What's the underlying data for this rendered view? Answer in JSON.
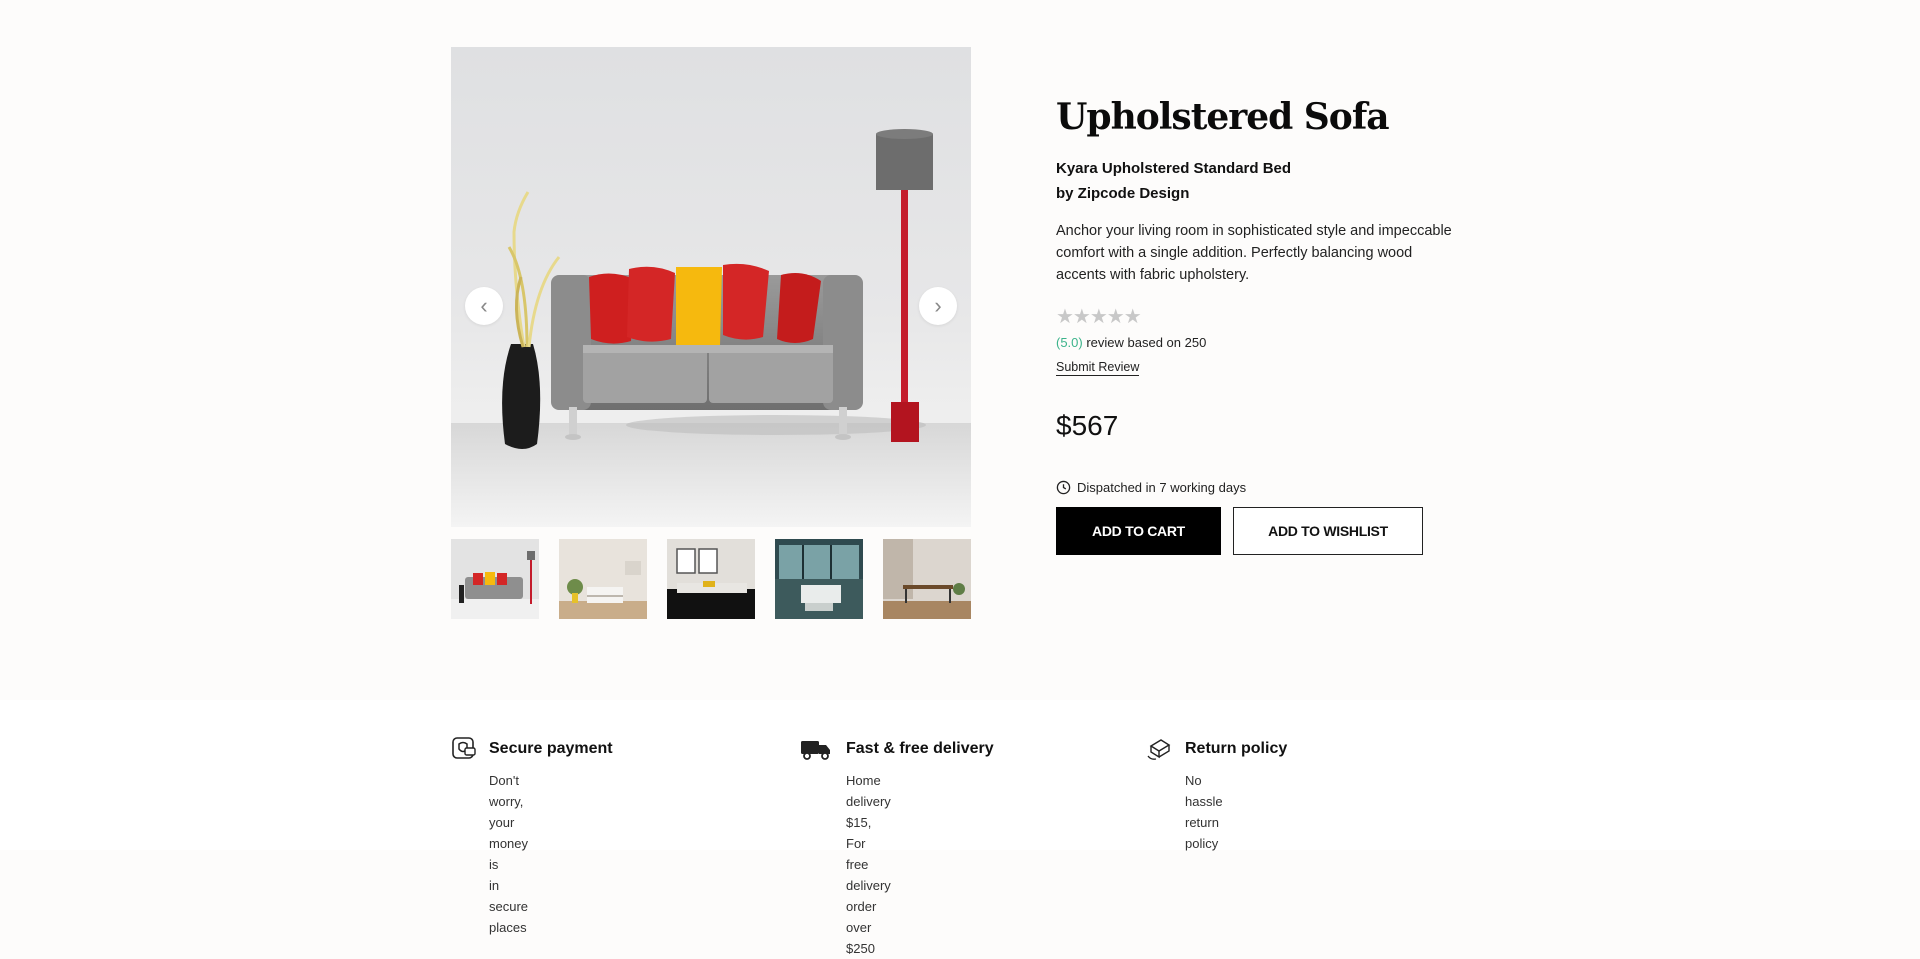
{
  "gallery": {
    "prev_icon": "‹",
    "next_icon": "›",
    "thumbnails": [
      "thumbnail-1",
      "thumbnail-2",
      "thumbnail-3",
      "thumbnail-4",
      "thumbnail-5"
    ]
  },
  "product": {
    "title": "Upholstered Sofa",
    "subtitle_line1": "Kyara Upholstered Standard Bed",
    "subtitle_line2": "by Zipcode Design",
    "description": "Anchor your living room in sophisticated style and impeccable comfort with a single addition. Perfectly balancing wood accents with fabric upholstery.",
    "stars": "★★★★★",
    "rating_value": 0,
    "rating_score": "(5.0)",
    "rating_text": " review based on 250",
    "submit_review": "Submit Review",
    "price": "$567",
    "dispatch": "Dispatched in 7 working days",
    "add_to_cart": "ADD TO CART",
    "add_to_wishlist": "ADD TO WISHLIST"
  },
  "features": [
    {
      "icon": "secure-payment-icon",
      "title": "Secure payment",
      "line1": "Don't worry, your money is",
      "line2": "in secure places"
    },
    {
      "icon": "delivery-truck-icon",
      "title": "Fast & free delivery",
      "line1": "Home delivery $15, For free",
      "line2": "delivery order over $250"
    },
    {
      "icon": "return-policy-icon",
      "title": "Return policy",
      "line1": "No hassle return policy",
      "line2": ""
    }
  ],
  "colors": {
    "accent_green": "#3bb38a",
    "cushion_red": "#d42020",
    "cushion_yellow": "#f6b90e",
    "button_black": "#000000"
  }
}
